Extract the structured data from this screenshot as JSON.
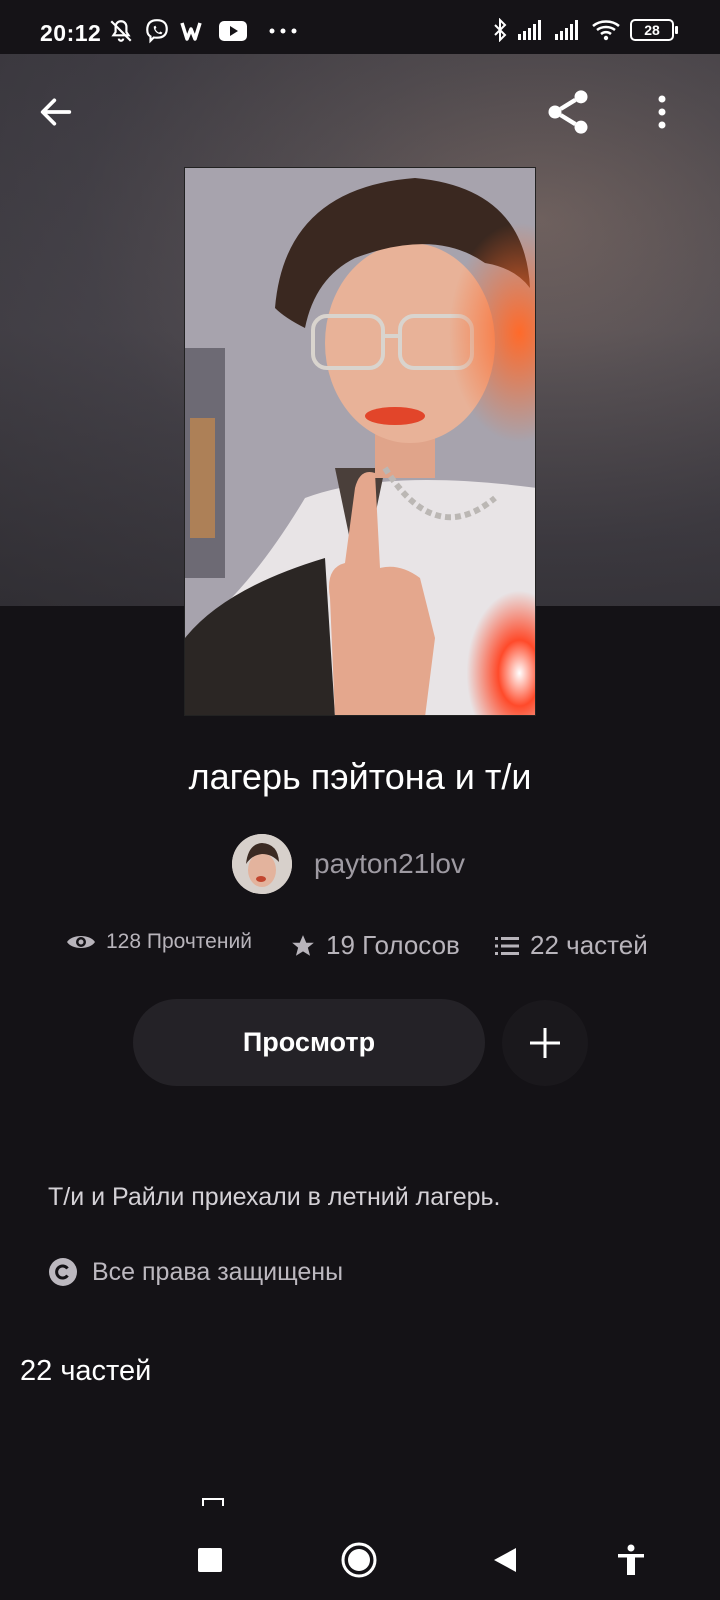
{
  "status_bar": {
    "time": "20:12",
    "battery": "28",
    "icons_left": [
      "notifications-off-icon",
      "viber-icon",
      "w-app-icon",
      "youtube-icon",
      "more-dots-icon"
    ],
    "icons_right": [
      "bluetooth-icon",
      "signal-icon",
      "signal-icon",
      "wifi-icon",
      "battery-icon"
    ]
  },
  "header": {
    "back_icon": "arrow-left-icon",
    "share_icon": "share-icon",
    "more_icon": "more-vertical-icon"
  },
  "story": {
    "title": "лагерь пэйтона и т/и",
    "author": "payton21lov",
    "stats": {
      "reads": "128 Прочтений",
      "votes": "19 Голосов",
      "parts": "22 частей"
    },
    "read_button": "Просмотр",
    "add_icon": "plus-icon",
    "description": "Т/и и Райли приехали в летний лагерь.",
    "copyright": "Все права защищены",
    "parts_heading": "22 частей"
  },
  "nav_bar": {
    "items": [
      "recents-square-icon",
      "home-circle-icon",
      "back-triangle-icon",
      "accessibility-icon"
    ]
  },
  "colors": {
    "background": "#141216",
    "button_bg": "#242227",
    "secondary_text": "#9e9aa2"
  }
}
